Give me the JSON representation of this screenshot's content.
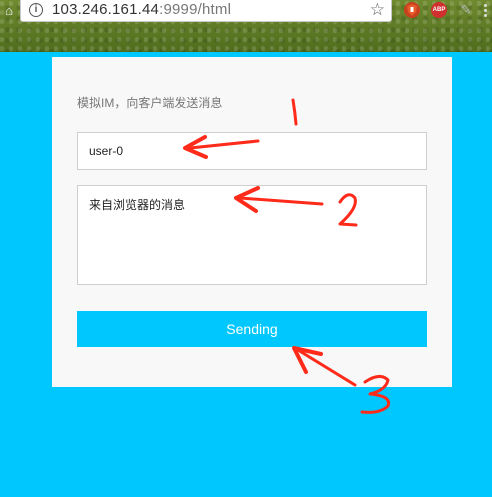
{
  "browser": {
    "url_host": "103.246.161.44",
    "url_rest": ":9999/html",
    "bookmark_icon": "star-icon",
    "extensions": [
      "ublock-icon",
      "abp-icon",
      "pin-icon",
      "menu-icon"
    ],
    "abp_label": "ABP"
  },
  "form": {
    "heading": "模拟IM，向客户端发送消息",
    "user_value": "user-0",
    "message_value": "来自浏览器的消息",
    "send_label": "Sending"
  },
  "annotations": {
    "marks": [
      "1",
      "2",
      "3"
    ],
    "color": "#ff2b1a"
  },
  "colors": {
    "page_background": "#00c8ff",
    "card_background": "#f8f8f8",
    "button_background": "#00c8ff"
  }
}
